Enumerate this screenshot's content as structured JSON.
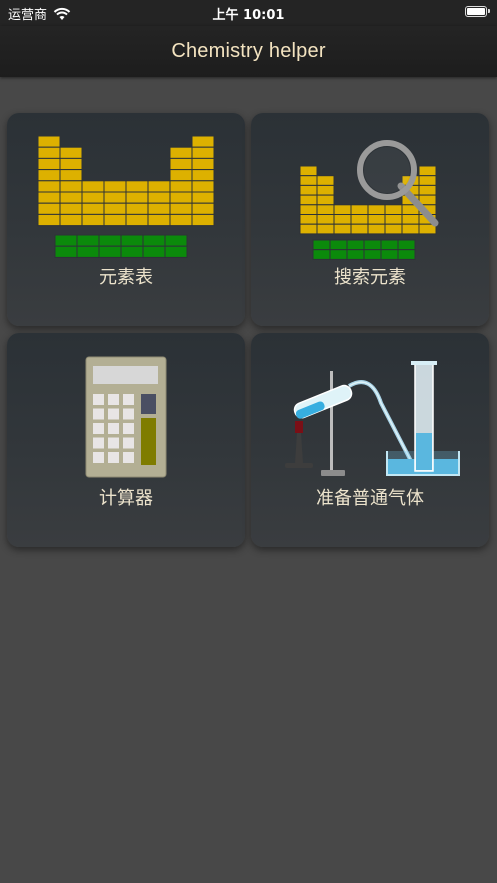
{
  "status_bar": {
    "carrier": "运营商",
    "time": "上午 10:01"
  },
  "nav": {
    "title": "Chemistry helper"
  },
  "tiles": [
    {
      "label": "元素表",
      "icon": "periodic-table-icon"
    },
    {
      "label": "搜索元素",
      "icon": "element-search-icon"
    },
    {
      "label": "计算器",
      "icon": "calculator-icon"
    },
    {
      "label": "准备普通气体",
      "icon": "gas-apparatus-icon"
    }
  ],
  "colors": {
    "background": "#484848",
    "navbar": "#242424",
    "title_text": "#f3e3c0",
    "tile_label": "#ece3cc",
    "element_yellow": "#ddb100",
    "element_green": "#0b8a0b"
  }
}
